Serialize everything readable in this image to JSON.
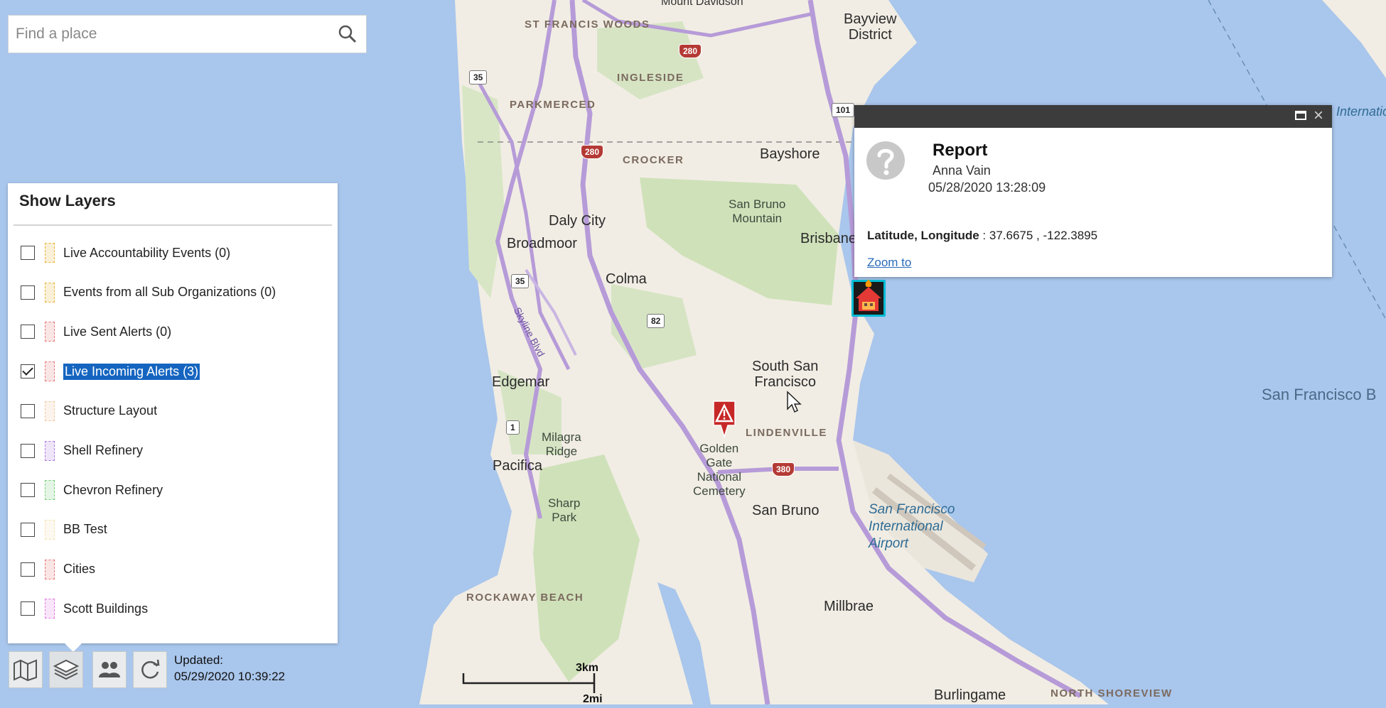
{
  "search": {
    "placeholder": "Find a place"
  },
  "layers_panel": {
    "title": "Show Layers",
    "items": [
      {
        "label": "Live Accountability Events (0)",
        "checked": false,
        "color": "#e8b53a"
      },
      {
        "label": "Events from all Sub Organizations (0)",
        "checked": false,
        "color": "#e8b53a"
      },
      {
        "label": "Live Sent Alerts (0)",
        "checked": false,
        "color": "#e77b7b"
      },
      {
        "label": "Live Incoming Alerts (3)",
        "checked": true,
        "color": "#e77b7b",
        "selected": true
      },
      {
        "label": "Structure Layout",
        "checked": false,
        "color": "#f0c9a0"
      },
      {
        "label": "Shell Refinery",
        "checked": false,
        "color": "#b07be0"
      },
      {
        "label": "Chevron Refinery",
        "checked": false,
        "color": "#7ccf7c"
      },
      {
        "label": "BB Test",
        "checked": false,
        "color": "#f3e3b5"
      },
      {
        "label": "Cities",
        "checked": false,
        "color": "#e77b7b"
      },
      {
        "label": "Scott Buildings",
        "checked": false,
        "color": "#e07be0"
      }
    ]
  },
  "toolbar": {
    "buttons": [
      "map-icon",
      "layers-icon",
      "users-icon",
      "refresh-icon"
    ],
    "updated_label": "Updated:",
    "updated_value": "05/29/2020 10:39:22"
  },
  "scale": {
    "km": "3km",
    "mi": "2mi"
  },
  "popup": {
    "title": "Report",
    "author": "Anna Vain",
    "timestamp": "05/28/2020 13:28:09",
    "coords_label": "Latitude, Longitude",
    "coords_value": " : 37.6675 , -122.3895",
    "zoom_link": "Zoom to"
  },
  "map": {
    "labels": {
      "st_francis_woods": "ST FRANCIS WOODS",
      "mount_davidson": "Mount Davidson",
      "bayview_district": "Bayview\nDistrict",
      "ingleside": "INGLESIDE",
      "parkmerced": "PARKMERCED",
      "crocker": "CROCKER",
      "bayshore": "Bayshore",
      "daly_city": "Daly City",
      "broadmoor": "Broadmoor",
      "san_bruno_mountain": "San Bruno\nMountain",
      "brisbane": "Brisbane",
      "colma": "Colma",
      "skyline_blvd": "Skyline Blvd",
      "south_san_francisco": "South San\nFrancisco",
      "edgemar": "Edgemar",
      "lindenville": "LINDENVILLE",
      "milagra_ridge": "Milagra\nRidge",
      "pacifica": "Pacifica",
      "golden_gate_cemetery": "Golden\nGate\nNational\nCemetery",
      "san_bruno": "San Bruno",
      "sfo": "San Francisco\nInternational\nAirport",
      "sharp_park": "Sharp\nPark",
      "rockaway_beach": "ROCKAWAY BEACH",
      "millbrae": "Millbrae",
      "burlingame": "Burlingame",
      "north_shoreview": "NORTH SHOREVIEW",
      "san_francisco_bay": "San Francisco B",
      "international": "Internatio"
    },
    "shields": {
      "i280_top": "280",
      "i280_mid": "280",
      "i380": "380",
      "sr35_top": "35",
      "sr35_mid": "35",
      "us101": "101",
      "sr82": "82",
      "sr1": "1"
    }
  }
}
